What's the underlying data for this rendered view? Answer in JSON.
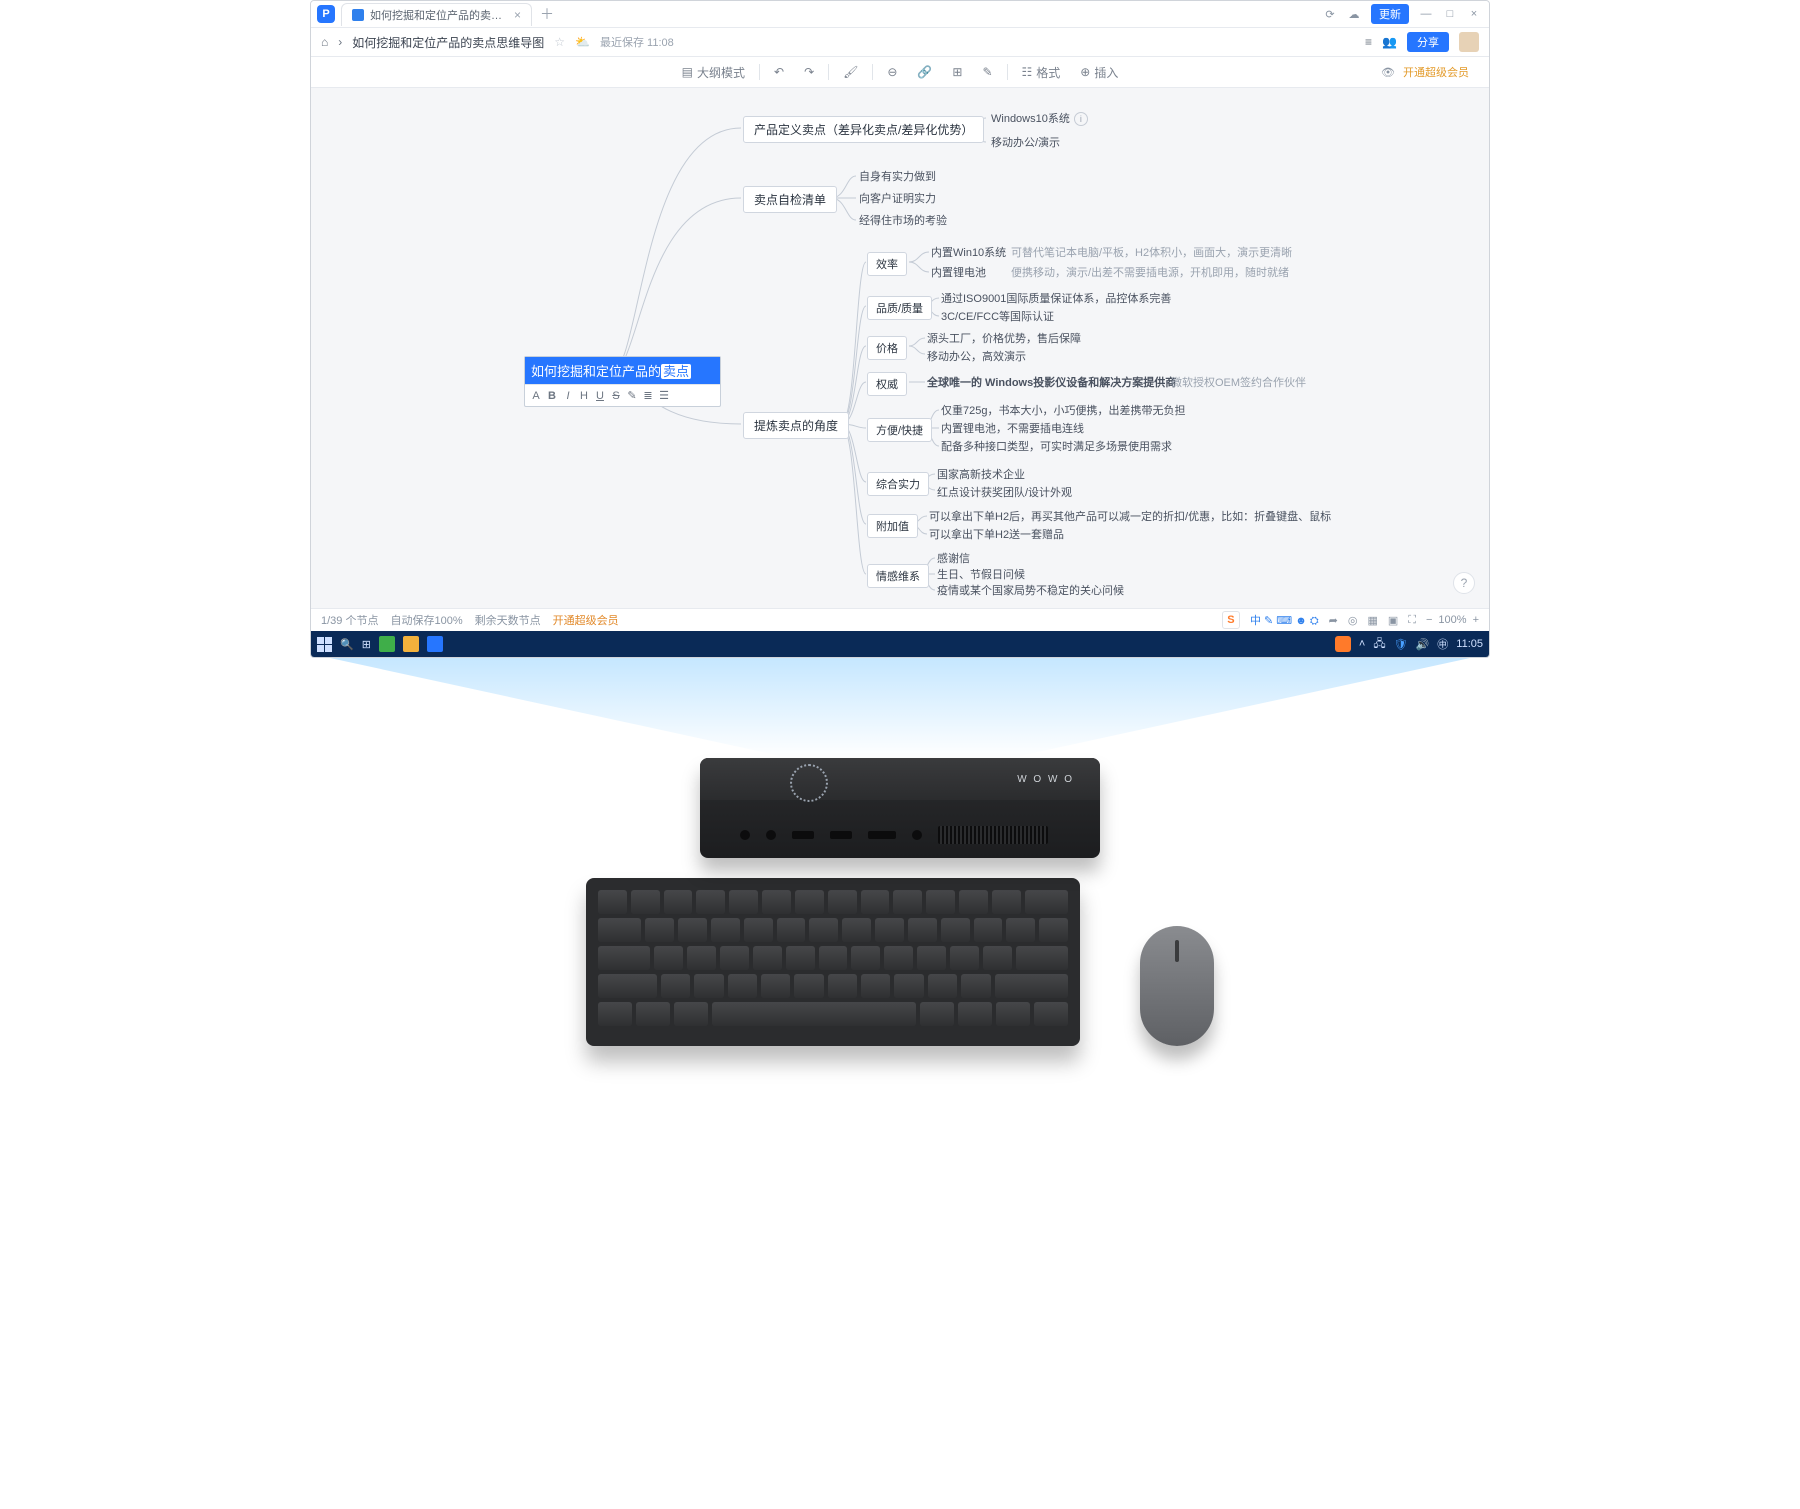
{
  "titlebar": {
    "app_initial": "P",
    "tab_title": "如何挖掘和定位产品的卖…",
    "update_label": "更新"
  },
  "crumb": {
    "doc_title": "如何挖掘和定位产品的卖点思维导图",
    "autosave": "最近保存 11:08",
    "share": "分享"
  },
  "toolbar": {
    "outline": "大纲模式",
    "format": "格式",
    "insert": "插入",
    "upgrade": "开通超级会员"
  },
  "mindmap": {
    "root_prefix": "如何挖掘和定位产品的",
    "root_sel": "卖点",
    "fmt": {
      "a": "A",
      "b": "B",
      "i": "I",
      "h": "H",
      "u": "U",
      "s": "S",
      "pen": "✎",
      "list": "≣",
      "ol": "☰"
    },
    "n1": "产品定义卖点（差异化卖点/差异化优势）",
    "n1a": "Windows10系统",
    "n1b": "移动办公/演示",
    "n2": "卖点自检清单",
    "n2a": "自身有实力做到",
    "n2b": "向客户证明实力",
    "n2c": "经得住市场的考验",
    "n3": "提炼卖点的角度",
    "n3_1": "效率",
    "n3_1a": "内置Win10系统",
    "n3_1a_note": "可替代笔记本电脑/平板，H2体积小，画面大，演示更清晰",
    "n3_1b": "内置锂电池",
    "n3_1b_note": "便携移动，演示/出差不需要插电源，开机即用，随时就绪",
    "n3_2": "品质/质量",
    "n3_2a": "通过ISO9001国际质量保证体系，品控体系完善",
    "n3_2b": "3C/CE/FCC等国际认证",
    "n3_3": "价格",
    "n3_3a": "源头工厂，价格优势，售后保障",
    "n3_3b": "移动办公，高效演示",
    "n3_4": "权威",
    "n3_4a": "全球唯一的 Windows投影仪设备和解决方案提供商",
    "n3_4a_note": "微软授权OEM签约合作伙伴",
    "n3_5": "方便/快捷",
    "n3_5a": "仅重725g，书本大小，小巧便携，出差携带无负担",
    "n3_5b": "内置锂电池，不需要插电连线",
    "n3_5c": "配备多种接口类型，可实时满足多场景使用需求",
    "n3_6": "综合实力",
    "n3_6a": "国家高新技术企业",
    "n3_6b": "红点设计获奖团队/设计外观",
    "n3_7": "附加值",
    "n3_7a": "可以拿出下单H2后，再买其他产品可以减一定的折扣/优惠，比如：折叠键盘、鼠标",
    "n3_7b": "可以拿出下单H2送一套赠品",
    "n3_8": "情感维系",
    "n3_8a": "感谢信",
    "n3_8b": "生日、节假日问候",
    "n3_8c": "疫情或某个国家局势不稳定的关心问候"
  },
  "status": {
    "nodes": "1/39 个节点",
    "saved": "自动保存100%",
    "space": "剩余天数节点",
    "upgrade": "开通超级会员",
    "zoom": "100%"
  },
  "taskbar": {
    "time": "11:05"
  },
  "hardware": {
    "brand": "W O W O"
  }
}
